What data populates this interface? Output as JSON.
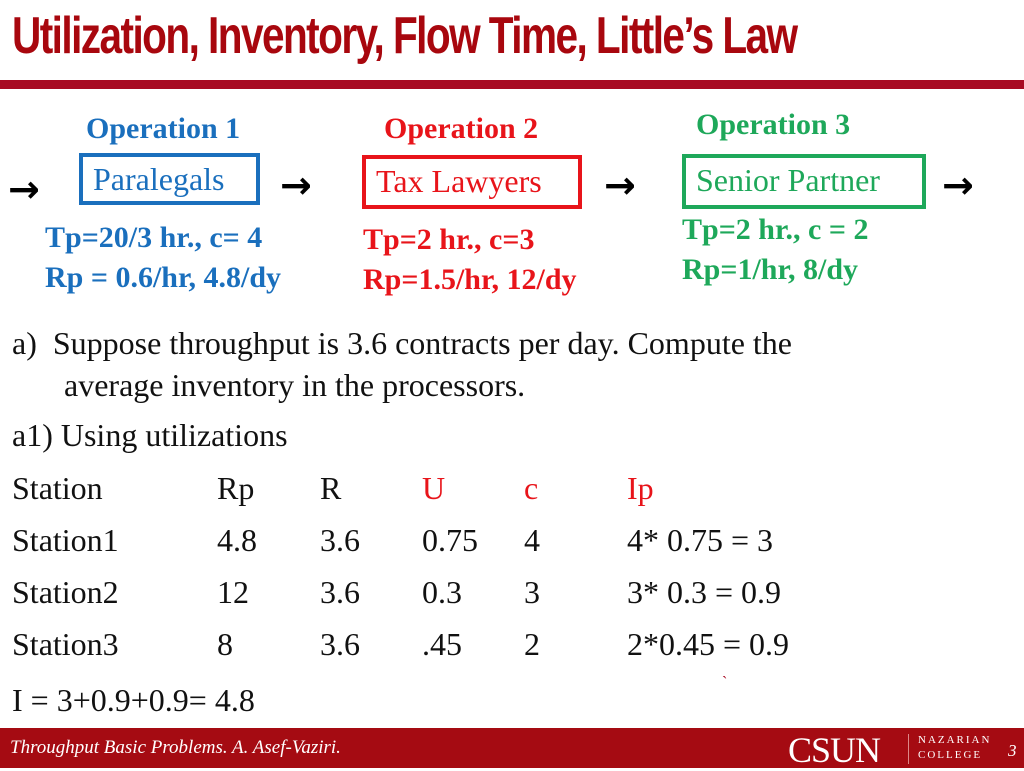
{
  "slide": {
    "title": "Utilization, Inventory, Flow Time, Little’s Law"
  },
  "colors": {
    "title": "#a8070e",
    "operation1": "#1a6fbd",
    "operation2": "#e8141a",
    "operation3": "#1ea85a",
    "footer_bg": "#a50b12"
  },
  "flow": {
    "arrow_icon": "→",
    "operations": [
      {
        "label": "Operation 1",
        "resource": "Paralegals",
        "tp_line": "Tp=20/3 hr., c= 4",
        "rp_line": "Rp = 0.6/hr, 4.8/dy"
      },
      {
        "label": "Operation 2",
        "resource": "Tax Lawyers",
        "tp_line": "Tp=2 hr., c=3",
        "rp_line": "Rp=1.5/hr, 12/dy"
      },
      {
        "label": "Operation 3",
        "resource": "Senior Partner",
        "tp_line": "Tp=2 hr., c = 2",
        "rp_line": "Rp=1/hr, 8/dy"
      }
    ]
  },
  "question": {
    "marker": "a)",
    "line1": "Suppose throughput is 3.6 contracts per day. Compute the",
    "line2": "average inventory in the processors.",
    "sub": "a1) Using utilizations"
  },
  "table": {
    "headers": [
      "Station",
      "Rp",
      "R",
      "U",
      "c",
      "Ip"
    ],
    "rows": [
      [
        "Station1",
        "4.8",
        "3.6",
        "0.75",
        "4",
        "4* 0.75 = 3"
      ],
      [
        "Station2",
        "12",
        "3.6",
        "0.3",
        "3",
        "3* 0.3 = 0.9"
      ],
      [
        "Station3",
        "8",
        "3.6",
        ".45",
        "2",
        "2*0.45 = 0.9"
      ]
    ],
    "total": "I = 3+0.9+0.9= 4.8",
    "stray_mark": "`"
  },
  "footer": {
    "text": "Throughput Basic Problems. A. Asef-Vaziri.",
    "logo": "CSUN",
    "college_line1": "NAZARIAN",
    "college_line2": "COLLEGE",
    "page_number": "3"
  }
}
